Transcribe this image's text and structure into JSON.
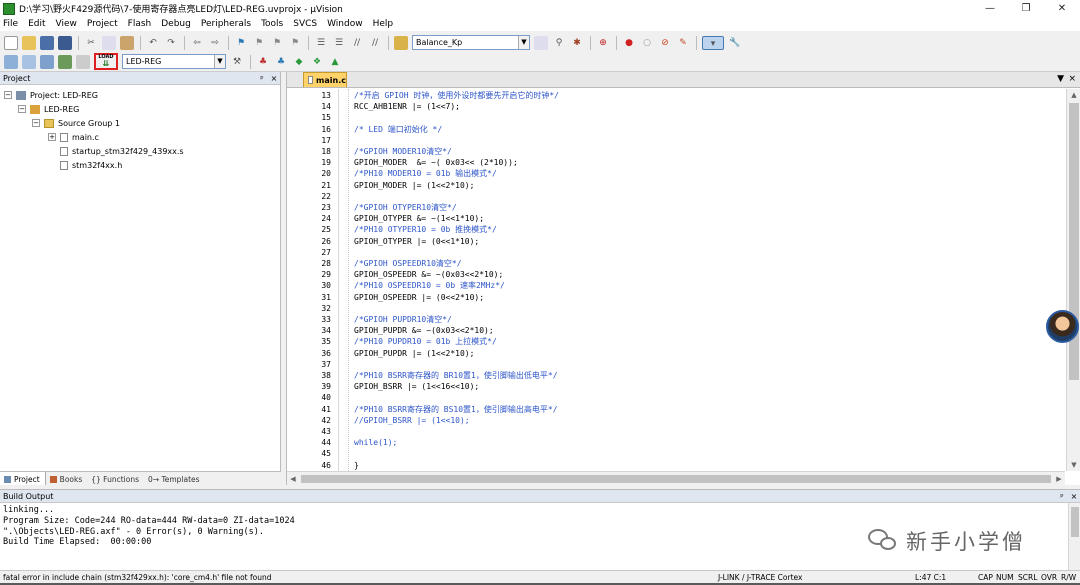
{
  "window": {
    "title": "D:\\学习\\野火F429源代码\\7-使用寄存器点亮LED灯\\LED-REG.uvprojx - µVision",
    "minimize": "—",
    "restore": "❐",
    "close": "✕"
  },
  "menu": [
    "File",
    "Edit",
    "View",
    "Project",
    "Flash",
    "Debug",
    "Peripherals",
    "Tools",
    "SVCS",
    "Window",
    "Help"
  ],
  "toolbar": {
    "find_combo_value": "Balance_Kp",
    "target_combo_value": "LED-REG",
    "load_label": "LOAD"
  },
  "project_panel": {
    "title": "Project",
    "pin": "ᵖ",
    "close": "×",
    "tree": {
      "project": "Project: LED-REG",
      "target": "LED-REG",
      "group": "Source Group 1",
      "files": [
        "main.c",
        "startup_stm32f429_439xx.s",
        "stm32f4xx.h"
      ]
    },
    "tabs": [
      "Project",
      "Books",
      "{} Functions",
      "0→ Templates"
    ]
  },
  "editor": {
    "active_tab": "main.c",
    "lines": [
      {
        "n": "13",
        "code": "/*开启 GPIOH 时钟，使用外设时都要先开启它的时钟*/",
        "kind": "comment"
      },
      {
        "n": "14",
        "code": "RCC_AHB1ENR |= (1<<7);",
        "kind": "text"
      },
      {
        "n": "15",
        "code": "",
        "kind": "text"
      },
      {
        "n": "16",
        "code": "/* LED 端口初始化 */",
        "kind": "comment"
      },
      {
        "n": "17",
        "code": "",
        "kind": "text"
      },
      {
        "n": "18",
        "code": "/*GPIOH MODER10清空*/",
        "kind": "comment"
      },
      {
        "n": "19",
        "code": "GPIOH_MODER  &= ~( 0x03<< (2*10));",
        "kind": "text"
      },
      {
        "n": "20",
        "code": "/*PH10 MODER10 = 01b 输出模式*/",
        "kind": "comment"
      },
      {
        "n": "21",
        "code": "GPIOH_MODER |= (1<<2*10);",
        "kind": "text"
      },
      {
        "n": "22",
        "code": "",
        "kind": "text"
      },
      {
        "n": "23",
        "code": "/*GPIOH OTYPER10清空*/",
        "kind": "comment"
      },
      {
        "n": "24",
        "code": "GPIOH_OTYPER &= ~(1<<1*10);",
        "kind": "text"
      },
      {
        "n": "25",
        "code": "/*PH10 OTYPER10 = 0b 推挽模式*/",
        "kind": "comment"
      },
      {
        "n": "26",
        "code": "GPIOH_OTYPER |= (0<<1*10);",
        "kind": "text"
      },
      {
        "n": "27",
        "code": "",
        "kind": "text"
      },
      {
        "n": "28",
        "code": "/*GPIOH OSPEEDR10清空*/",
        "kind": "comment"
      },
      {
        "n": "29",
        "code": "GPIOH_OSPEEDR &= ~(0x03<<2*10);",
        "kind": "text"
      },
      {
        "n": "30",
        "code": "/*PH10 OSPEEDR10 = 0b 速率2MHz*/",
        "kind": "comment"
      },
      {
        "n": "31",
        "code": "GPIOH_OSPEEDR |= (0<<2*10);",
        "kind": "text"
      },
      {
        "n": "32",
        "code": "",
        "kind": "text"
      },
      {
        "n": "33",
        "code": "/*GPIOH PUPDR10清空*/",
        "kind": "comment"
      },
      {
        "n": "34",
        "code": "GPIOH_PUPDR &= ~(0x03<<2*10);",
        "kind": "text"
      },
      {
        "n": "35",
        "code": "/*PH10 PUPDR10 = 01b 上拉模式*/",
        "kind": "comment"
      },
      {
        "n": "36",
        "code": "GPIOH_PUPDR |= (1<<2*10);",
        "kind": "text"
      },
      {
        "n": "37",
        "code": "",
        "kind": "text"
      },
      {
        "n": "38",
        "code": "/*PH10 BSRR寄存器的 BR10置1，使引脚输出低电平*/",
        "kind": "comment"
      },
      {
        "n": "39",
        "code": "GPIOH_BSRR |= (1<<16<<10);",
        "kind": "text"
      },
      {
        "n": "40",
        "code": "",
        "kind": "text"
      },
      {
        "n": "41",
        "code": "/*PH10 BSRR寄存器的 BS10置1，使引脚输出高电平*/",
        "kind": "comment"
      },
      {
        "n": "42",
        "code": "//GPIOH_BSRR |= (1<<10);",
        "kind": "comment"
      },
      {
        "n": "43",
        "code": "",
        "kind": "text"
      },
      {
        "n": "44",
        "code": "while(1);",
        "kind": "kw"
      },
      {
        "n": "45",
        "code": "",
        "kind": "text"
      },
      {
        "n": "46",
        "code": "}",
        "kind": "text"
      }
    ]
  },
  "build_output": {
    "title": "Build Output",
    "lines": [
      "linking...",
      "Program Size: Code=244 RO-data=444 RW-data=0 ZI-data=1024",
      "\".\\Objects\\LED-REG.axf\" - 0 Error(s), 0 Warning(s).",
      "Build Time Elapsed:  00:00:00"
    ],
    "watermark": "新手小学僧"
  },
  "status_bar": {
    "message": "fatal error in include chain (stm32f429xx.h): 'core_cm4.h' file not found",
    "debugger": "J-LINK / J-TRACE Cortex",
    "position": "L:47 C:1",
    "indicators": [
      "CAP",
      "NUM",
      "SCRL",
      "OVR",
      "R/W"
    ]
  },
  "colors": {
    "comment": "#2e56c9",
    "tab_active": "#ffd36a",
    "load_highlight": "#e02020"
  }
}
